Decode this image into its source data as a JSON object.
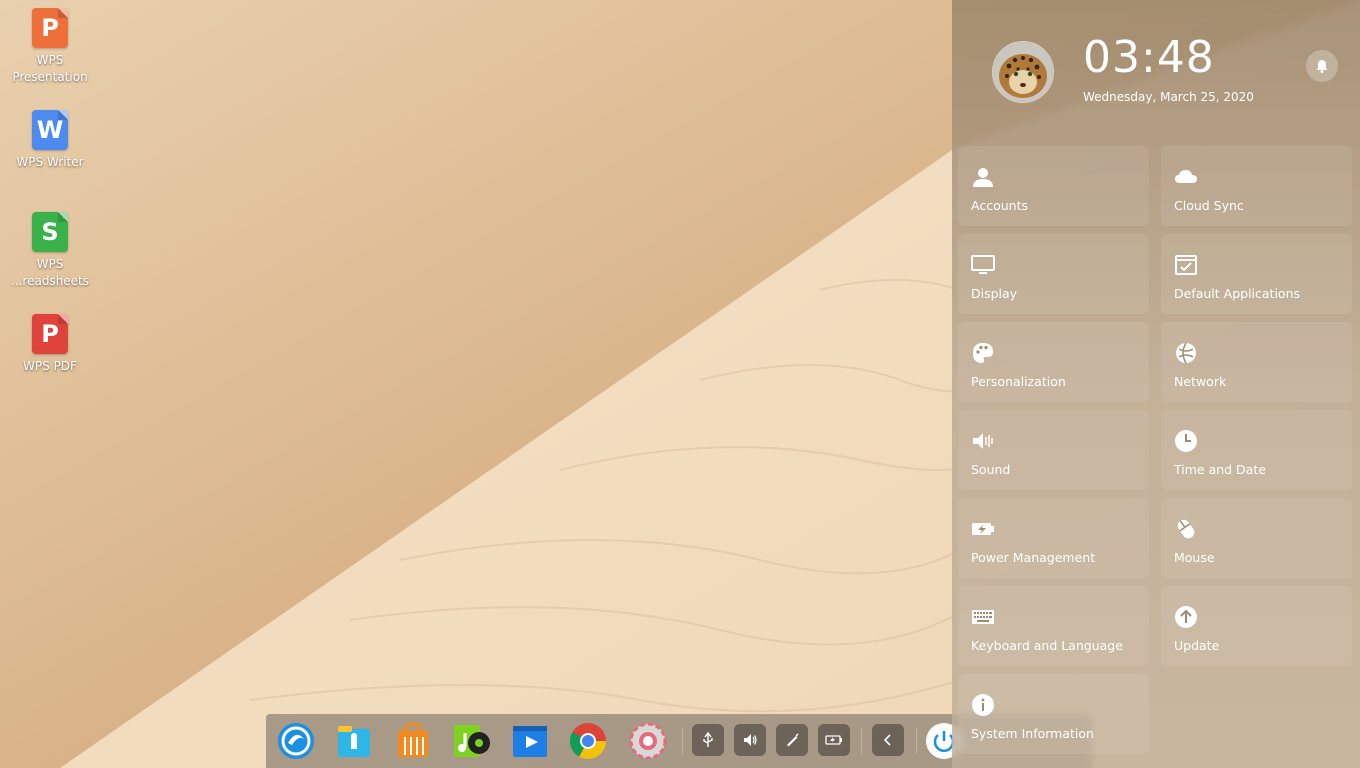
{
  "desktop": {
    "icons": [
      {
        "label": "WPS Presentation",
        "line1": "WPS",
        "line2": "Presentation",
        "glyph": "P",
        "color": "#ee6f3a"
      },
      {
        "label": "WPS Writer",
        "line1": "WPS Writer",
        "line2": "",
        "glyph": "W",
        "color": "#4d8bf0"
      },
      {
        "label": "WPS ...readsheets",
        "line1": "WPS",
        "line2": "...readsheets",
        "glyph": "S",
        "color": "#3bb14a"
      },
      {
        "label": "WPS PDF",
        "line1": "WPS PDF",
        "line2": "",
        "glyph": "P",
        "color": "#e0433b"
      }
    ]
  },
  "control_center": {
    "time": "03:48",
    "date": "Wednesday, March 25, 2020",
    "tiles": [
      {
        "label": "Accounts",
        "icon": "user-icon"
      },
      {
        "label": "Cloud Sync",
        "icon": "cloud-icon"
      },
      {
        "label": "Display",
        "icon": "monitor-icon"
      },
      {
        "label": "Default Applications",
        "icon": "default-apps-icon"
      },
      {
        "label": "Personalization",
        "icon": "palette-icon"
      },
      {
        "label": "Network",
        "icon": "globe-icon"
      },
      {
        "label": "Sound",
        "icon": "speaker-icon"
      },
      {
        "label": "Time and Date",
        "icon": "clock-icon"
      },
      {
        "label": "Power Management",
        "icon": "battery-icon"
      },
      {
        "label": "Mouse",
        "icon": "mouse-icon"
      },
      {
        "label": "Keyboard and Language",
        "icon": "keyboard-icon"
      },
      {
        "label": "Update",
        "icon": "update-icon"
      },
      {
        "label": "System Information",
        "icon": "info-icon"
      }
    ]
  },
  "dock": {
    "apps": [
      "launcher-icon",
      "file-manager-icon",
      "app-store-icon",
      "music-icon",
      "video-icon",
      "chrome-icon",
      "settings-icon"
    ],
    "tray": [
      "usb-icon",
      "volume-icon",
      "pen-icon",
      "battery-icon"
    ],
    "collapse": "chevron-left-icon",
    "power": "power-icon"
  }
}
